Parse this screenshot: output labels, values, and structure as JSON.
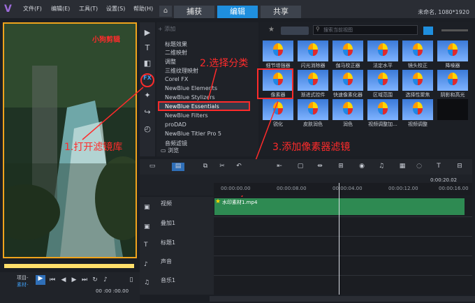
{
  "app": {
    "project_info": "未命名, 1080*1920"
  },
  "menu": {
    "file": "文件(F)",
    "edit": "编辑(E)",
    "tools": "工具(T)",
    "settings": "设置(S)",
    "help": "帮助(H)"
  },
  "tabs": {
    "capture": "捕获",
    "edit": "编辑",
    "share": "共享"
  },
  "preview": {
    "watermark": "小狗剪辑",
    "project_label": "项目-",
    "clip_label": "素材-",
    "timecode": "00 :00 :00.00"
  },
  "library": {
    "add_label": "添加",
    "browse_label": "浏览",
    "search_placeholder": "搜索当前视图",
    "categories": [
      "标题效果",
      "二维映射",
      "调整",
      "三维纹理映射",
      "Corel FX",
      "NewBlue Elements",
      "NewBlue Stylizers",
      "NewBlue Essentials",
      "NewBlue Filters",
      "proDAD",
      "NewBlue Titler Pro 5",
      "音频滤镜"
    ],
    "effects": [
      "细节增强器",
      "闪光消除器",
      "伽马校正器",
      "法定水平",
      "镜头校正",
      "降噪器",
      "像素器",
      "渐进式控件",
      "快速像素化器",
      "区域范围",
      "选择性聚焦",
      "阴影和高光",
      "锐化",
      "皮肤润色",
      "润色",
      "视频调整加...",
      "视频调整",
      ""
    ]
  },
  "annotations": {
    "step1": "1.打开滤镜库",
    "step2": "2.选择分类",
    "step3": "3.添加像素器滤镜"
  },
  "timeline": {
    "timecode": "0:00:20.02",
    "ruler": [
      "00:00:00.00",
      "00:00:08.00",
      "00:00:04.00",
      "00:00:12.00",
      "00:00:16.00"
    ],
    "tracks": [
      "视频",
      "叠加1",
      "标题1",
      "声音",
      "音乐1"
    ],
    "clip_name": "水印素材1.mp4"
  },
  "colors": {
    "accent": "#1f8fde",
    "annotation": "#ff2b2b",
    "selection": "#f0a31c",
    "clip": "#2e8a52"
  }
}
